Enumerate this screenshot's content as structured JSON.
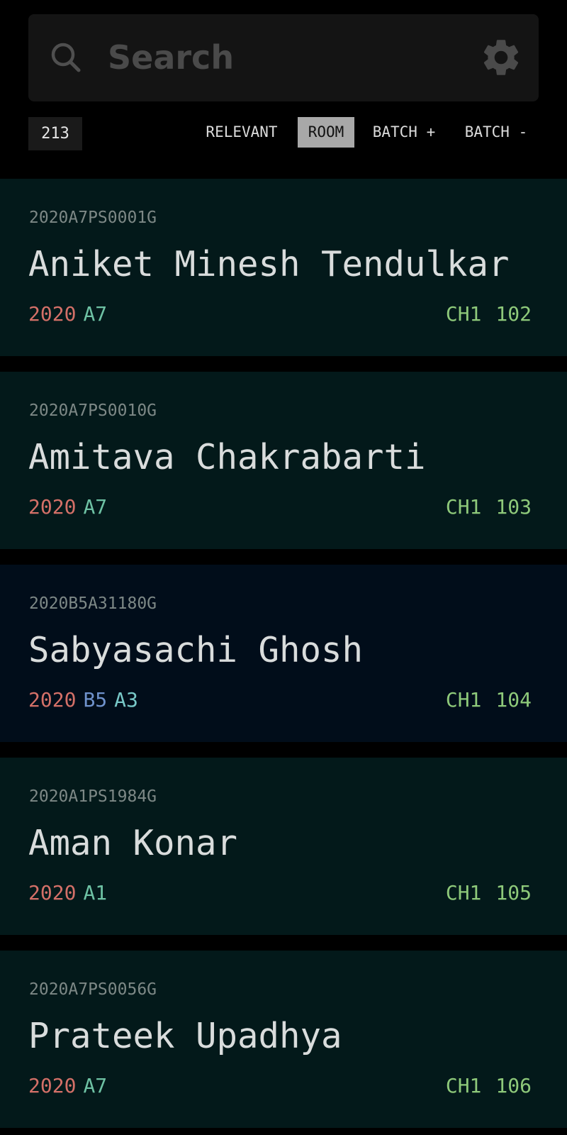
{
  "colors": {
    "background": "#000000",
    "search_bg": "#141414",
    "card_green_bg": "#03191a",
    "card_blue_bg": "#010d1a",
    "year": "#d47068",
    "branch_green": "#6ec2a4",
    "branch_blue": "#6f92cc",
    "branch_teal": "#78c8c8",
    "room": "#8ec97a",
    "active_sort_bg": "#a8a8a8"
  },
  "search": {
    "placeholder": "Search",
    "icon": "search-icon",
    "settings_icon": "gear-icon"
  },
  "result_count": "213",
  "sort_options": [
    {
      "label": "RELEVANT",
      "active": false
    },
    {
      "label": "ROOM",
      "active": true
    },
    {
      "label": "BATCH +",
      "active": false
    },
    {
      "label": "BATCH -",
      "active": false
    }
  ],
  "students": [
    {
      "id": "2020A7PS0001G",
      "name": "Aniket Minesh Tendulkar",
      "year": "2020",
      "branches": [
        "A7"
      ],
      "hostel": "CH1",
      "room": "102",
      "theme": "green"
    },
    {
      "id": "2020A7PS0010G",
      "name": "Amitava Chakrabarti",
      "year": "2020",
      "branches": [
        "A7"
      ],
      "hostel": "CH1",
      "room": "103",
      "theme": "green"
    },
    {
      "id": "2020B5A31180G",
      "name": "Sabyasachi Ghosh",
      "year": "2020",
      "branches": [
        "B5",
        "A3"
      ],
      "hostel": "CH1",
      "room": "104",
      "theme": "blue"
    },
    {
      "id": "2020A1PS1984G",
      "name": "Aman Konar",
      "year": "2020",
      "branches": [
        "A1"
      ],
      "hostel": "CH1",
      "room": "105",
      "theme": "green"
    },
    {
      "id": "2020A7PS0056G",
      "name": "Prateek Upadhya",
      "year": "2020",
      "branches": [
        "A7"
      ],
      "hostel": "CH1",
      "room": "106",
      "theme": "green"
    }
  ]
}
